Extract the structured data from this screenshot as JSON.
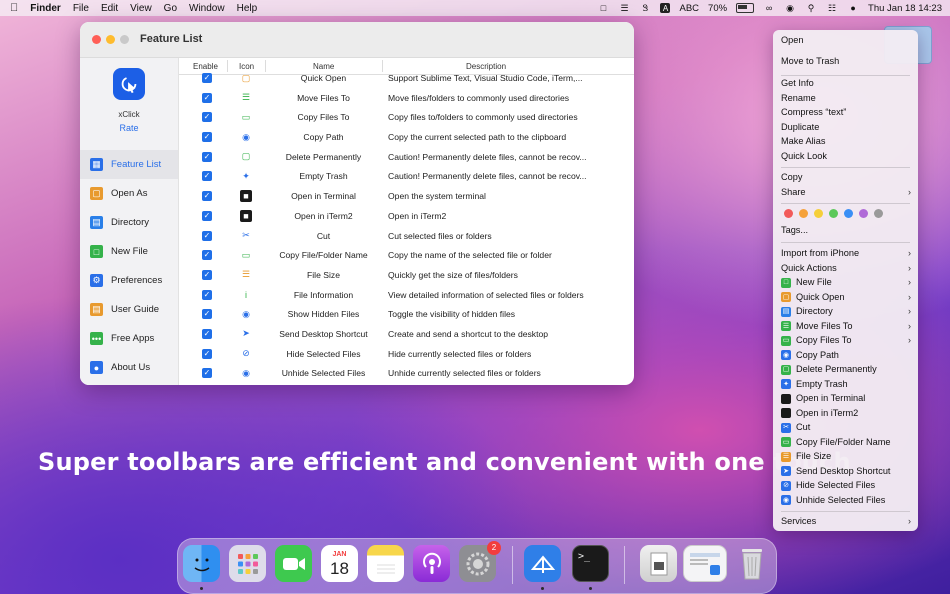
{
  "menubar": {
    "app_name": "Finder",
    "menus": [
      "File",
      "Edit",
      "View",
      "Go",
      "Window",
      "Help"
    ],
    "input_source": "ABC",
    "battery": "70%",
    "datetime": "Thu Jan 18  14:23"
  },
  "window": {
    "title": "Feature List",
    "app_name": "xClick",
    "rate_label": "Rate",
    "sidebar": [
      {
        "label": "Feature List",
        "icon": "grid-icon",
        "color": "#2a6fe8",
        "active": true
      },
      {
        "label": "Open As",
        "icon": "box-icon",
        "color": "#e89a2e"
      },
      {
        "label": "Directory",
        "icon": "folder-icon",
        "color": "#2a7fe8"
      },
      {
        "label": "New File",
        "icon": "file-icon",
        "color": "#35b24a"
      },
      {
        "label": "Preferences",
        "icon": "gear-icon",
        "color": "#2a6fe8"
      },
      {
        "label": "User Guide",
        "icon": "book-icon",
        "color": "#e89a2e"
      },
      {
        "label": "Free Apps",
        "icon": "dots-icon",
        "color": "#35b24a"
      },
      {
        "label": "About Us",
        "icon": "person-icon",
        "color": "#2a6fe8"
      }
    ],
    "columns": {
      "enable": "Enable",
      "icon": "Icon",
      "name": "Name",
      "description": "Description"
    },
    "rows": [
      {
        "name": "Quick Open",
        "desc": "Support Sublime Text, Visual Studio Code, iTerm,...",
        "icon": "box-icon",
        "color": "#e89a2e"
      },
      {
        "name": "Move Files To",
        "desc": "Move files/folders to commonly used directories",
        "icon": "move-icon",
        "color": "#35b24a"
      },
      {
        "name": "Copy Files To",
        "desc": "Copy files to/folders to commonly used directories",
        "icon": "copy-icon",
        "color": "#35b24a"
      },
      {
        "name": "Copy Path",
        "desc": "Copy the current selected path to the clipboard",
        "icon": "path-icon",
        "color": "#2a6fe8"
      },
      {
        "name": "Delete Permanently",
        "desc": "Caution! Permanently delete files, cannot be recov...",
        "icon": "trash-icon",
        "color": "#35b24a"
      },
      {
        "name": "Empty Trash",
        "desc": "Caution! Permanently delete files, cannot be recov...",
        "icon": "broom-icon",
        "color": "#2a6fe8"
      },
      {
        "name": "Open in Terminal",
        "desc": "Open the system terminal",
        "icon": "terminal-icon",
        "color": "#1a1a1a"
      },
      {
        "name": "Open in iTerm2",
        "desc": "Open in iTerm2",
        "icon": "iterm-icon",
        "color": "#1a1a1a"
      },
      {
        "name": "Cut",
        "desc": "Cut selected files or folders",
        "icon": "scissors-icon",
        "color": "#2a6fe8"
      },
      {
        "name": "Copy File/Folder Name",
        "desc": "Copy the name of the selected file or folder",
        "icon": "name-copy-icon",
        "color": "#35b24a"
      },
      {
        "name": "File Size",
        "desc": "Quickly get the size of files/folders",
        "icon": "size-icon",
        "color": "#e89a2e"
      },
      {
        "name": "File Information",
        "desc": "View detailed information of selected files or folders",
        "icon": "info-icon",
        "color": "#35b24a"
      },
      {
        "name": "Show Hidden Files",
        "desc": "Toggle the visibility of hidden files",
        "icon": "eye-icon",
        "color": "#2a6fe8"
      },
      {
        "name": "Send Desktop Shortcut",
        "desc": "Create and send a shortcut to the desktop",
        "icon": "shortcut-icon",
        "color": "#2a6fe8"
      },
      {
        "name": "Hide Selected Files",
        "desc": "Hide currently selected files or folders",
        "icon": "eye-slash-icon",
        "color": "#2a6fe8"
      },
      {
        "name": "Unhide Selected Files",
        "desc": "Unhide currently selected files or folders",
        "icon": "eye-icon",
        "color": "#2a6fe8"
      }
    ]
  },
  "headline": "Super toolbars are efficient and convenient with one touch",
  "context_menu": {
    "group1": [
      "Open",
      "Move to Trash"
    ],
    "group2": [
      "Get Info",
      "Rename",
      "Compress “text”",
      "Duplicate",
      "Make Alias",
      "Quick Look"
    ],
    "group3": [
      {
        "label": "Copy"
      },
      {
        "label": "Share",
        "submenu": true
      }
    ],
    "tag_colors": [
      "#f25a5a",
      "#f5a13a",
      "#f5cf3a",
      "#5cc85a",
      "#3a8ff5",
      "#b06ad8",
      "#9a9a9a"
    ],
    "tags_label": "Tags...",
    "group4": [
      {
        "label": "Import from iPhone",
        "submenu": true
      },
      {
        "label": "Quick Actions",
        "submenu": true
      }
    ],
    "group5": [
      {
        "label": "New File",
        "icon": "file-icon",
        "color": "#35b24a",
        "submenu": true
      },
      {
        "label": "Quick Open",
        "icon": "box-icon",
        "color": "#e89a2e",
        "submenu": true
      },
      {
        "label": "Directory",
        "icon": "folder-icon",
        "color": "#2a7fe8",
        "submenu": true
      },
      {
        "label": "Move Files To",
        "icon": "move-icon",
        "color": "#35b24a",
        "submenu": true
      },
      {
        "label": "Copy Files To",
        "icon": "copy-icon",
        "color": "#35b24a",
        "submenu": true
      },
      {
        "label": "Copy Path",
        "icon": "path-icon",
        "color": "#2a6fe8"
      },
      {
        "label": "Delete Permanently",
        "icon": "trash-icon",
        "color": "#35b24a"
      },
      {
        "label": "Empty Trash",
        "icon": "broom-icon",
        "color": "#2a6fe8"
      },
      {
        "label": "Open in Terminal",
        "icon": "terminal-icon",
        "color": "#1a1a1a"
      },
      {
        "label": "Open in iTerm2",
        "icon": "iterm-icon",
        "color": "#1a1a1a"
      },
      {
        "label": "Cut",
        "icon": "scissors-icon",
        "color": "#2a6fe8"
      },
      {
        "label": "Copy File/Folder Name",
        "icon": "name-copy-icon",
        "color": "#35b24a"
      },
      {
        "label": "File Size",
        "icon": "size-icon",
        "color": "#e89a2e"
      },
      {
        "label": "Send Desktop Shortcut",
        "icon": "shortcut-icon",
        "color": "#2a6fe8"
      },
      {
        "label": "Hide Selected Files",
        "icon": "eye-slash-icon",
        "color": "#2a6fe8"
      },
      {
        "label": "Unhide Selected Files",
        "icon": "eye-icon",
        "color": "#2a6fe8"
      }
    ],
    "services": {
      "label": "Services",
      "submenu": true
    }
  },
  "dock": {
    "calendar_month": "JAN",
    "calendar_day": "18",
    "settings_badge": "2",
    "apps": [
      {
        "name": "finder-icon",
        "running": true
      },
      {
        "name": "launchpad-icon"
      },
      {
        "name": "facetime-icon"
      },
      {
        "name": "calendar-icon"
      },
      {
        "name": "notes-icon"
      },
      {
        "name": "podcasts-icon"
      },
      {
        "name": "system-settings-icon"
      },
      {
        "name": "xclick-icon",
        "running": true
      },
      {
        "name": "terminal-icon",
        "running": true
      },
      {
        "name": "preview-icon"
      },
      {
        "name": "screen-icon"
      },
      {
        "name": "trash-icon"
      }
    ]
  }
}
